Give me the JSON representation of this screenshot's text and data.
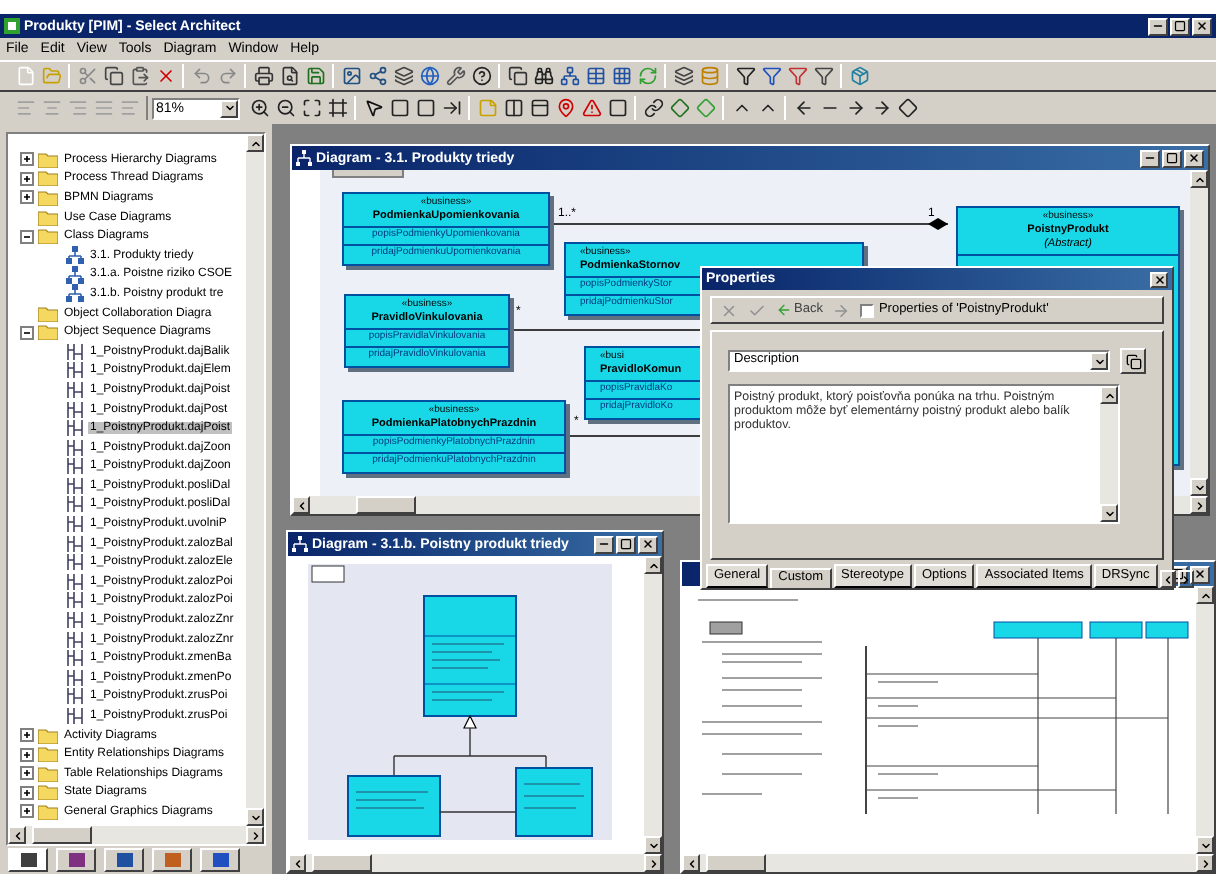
{
  "window": {
    "title": "Produkty [PIM] - Select Architect"
  },
  "menu": [
    "File",
    "Edit",
    "View",
    "Tools",
    "Diagram",
    "Window",
    "Help"
  ],
  "toolbar": {
    "zoom": "81%"
  },
  "tree": [
    {
      "label": "Process Hierarchy Diagrams",
      "kind": "folder",
      "expanded": false,
      "selected": false
    },
    {
      "label": "Process Thread Diagrams",
      "kind": "folder",
      "expanded": false,
      "selected": false
    },
    {
      "label": "BPMN Diagrams",
      "kind": "folder",
      "expanded": false,
      "selected": false
    },
    {
      "label": "Use Case Diagrams",
      "kind": "folder",
      "selected": false
    },
    {
      "label": "Class Diagrams",
      "kind": "folder",
      "expanded": true,
      "selected": false,
      "children": [
        {
          "label": "3.1. Produkty triedy",
          "kind": "class",
          "selected": false
        },
        {
          "label": "3.1.a. Poistne riziko CSOE",
          "kind": "class",
          "selected": false
        },
        {
          "label": "3.1.b. Poistny produkt tre",
          "kind": "class",
          "selected": false
        }
      ]
    },
    {
      "label": "Object Collaboration Diagra",
      "kind": "folder",
      "selected": false
    },
    {
      "label": "Object Sequence Diagrams",
      "kind": "folder",
      "expanded": true,
      "selected": false,
      "children": [
        {
          "label": "1_PoistnyProdukt.dajBalik",
          "kind": "sequence",
          "selected": false
        },
        {
          "label": "1_PoistnyProdukt.dajElem",
          "kind": "sequence",
          "selected": false
        },
        {
          "label": "1_PoistnyProdukt.dajPoist",
          "kind": "sequence",
          "selected": false
        },
        {
          "label": "1_PoistnyProdukt.dajPost",
          "kind": "sequence",
          "selected": false
        },
        {
          "label": "1_PoistnyProdukt.dajPoist",
          "kind": "sequence",
          "selected": true
        },
        {
          "label": "1_PoistnyProdukt.dajZoon",
          "kind": "sequence",
          "selected": false
        },
        {
          "label": "1_PoistnyProdukt.dajZoon",
          "kind": "sequence",
          "selected": false
        },
        {
          "label": "1_PoistnyProdukt.posliDal",
          "kind": "sequence",
          "selected": false
        },
        {
          "label": "1_PoistnyProdukt.posliDal",
          "kind": "sequence",
          "selected": false
        },
        {
          "label": "1_PoistnyProdukt.uvolniP",
          "kind": "sequence",
          "selected": false
        },
        {
          "label": "1_PoistnyProdukt.zalozBal",
          "kind": "sequence",
          "selected": false
        },
        {
          "label": "1_PoistnyProdukt.zalozEle",
          "kind": "sequence",
          "selected": false
        },
        {
          "label": "1_PoistnyProdukt.zalozPoi",
          "kind": "sequence",
          "selected": false
        },
        {
          "label": "1_PoistnyProdukt.zalozPoi",
          "kind": "sequence",
          "selected": false
        },
        {
          "label": "1_PoistnyProdukt.zalozZnr",
          "kind": "sequence",
          "selected": false
        },
        {
          "label": "1_PoistnyProdukt.zalozZnr",
          "kind": "sequence",
          "selected": false
        },
        {
          "label": "1_PoistnyProdukt.zmenBa",
          "kind": "sequence",
          "selected": false
        },
        {
          "label": "1_PoistnyProdukt.zmenPo",
          "kind": "sequence",
          "selected": false
        },
        {
          "label": "1_PoistnyProdukt.zrusPoi",
          "kind": "sequence",
          "selected": false
        },
        {
          "label": "1_PoistnyProdukt.zrusPoi",
          "kind": "sequence",
          "selected": false
        }
      ]
    },
    {
      "label": "Activity Diagrams",
      "kind": "folder",
      "expanded": false,
      "selected": false
    },
    {
      "label": "Entity Relationships Diagrams",
      "kind": "folder",
      "expanded": false,
      "selected": false
    },
    {
      "label": "Table Relationships Diagrams",
      "kind": "folder",
      "expanded": false,
      "selected": false
    },
    {
      "label": "State Diagrams",
      "kind": "folder",
      "expanded": false,
      "selected": false
    },
    {
      "label": "General Graphics Diagrams",
      "kind": "folder",
      "expanded": false,
      "selected": false
    }
  ],
  "navigator_tabs": [
    {
      "selected": true
    },
    {
      "selected": false
    },
    {
      "selected": false
    },
    {
      "selected": false
    },
    {
      "selected": false
    }
  ],
  "main_diagram": {
    "title": "Diagram - 3.1. Produkty triedy",
    "classes": [
      {
        "stereotype": "«business»",
        "name": "PodmienkaUpomienkovania",
        "operations": [
          "popisPodmienkyUpomienkovania",
          "pridajPodmienkuUpomienkovania"
        ]
      },
      {
        "stereotype": "«business»",
        "name": "PodmienkaStornov",
        "operations": [
          "popisPodmienkyStor",
          "pridajPodmienkuStor"
        ]
      },
      {
        "stereotype": "«business»",
        "name": "PravidloVinkulovania",
        "operations": [
          "popisPravidlaVinkulovania",
          "pridajPravidloVinkulovania"
        ]
      },
      {
        "stereotype": "«busi",
        "name": "PravidloKomun",
        "operations": [
          "popisPravidlaKo",
          "pridajPravidloKo"
        ]
      },
      {
        "stereotype": "«business»",
        "name": "PodmienkaPlatobnychPrazdnin",
        "operations": [
          "popisPodmienkyPlatobnychPrazdnin",
          "pridajPodmienkuPlatobnychPrazdnin"
        ]
      },
      {
        "stereotype": "«business»",
        "name": "PoistnyProdukt",
        "subtitle": "(Abstract)"
      }
    ],
    "multiplicities": [
      "1..*",
      "1",
      "*",
      "*"
    ]
  },
  "properties": {
    "title": "Properties",
    "back": "Back",
    "checkbox": {
      "label": "Properties of 'PoistnyProdukt'",
      "checked": false
    },
    "field": "Description",
    "text": "Poistný produkt, ktorý poisťovňa ponúka na trhu. Poistným produktom môže byť elementárny poistný produkt alebo balík produktov.",
    "tabs": [
      {
        "label": "General",
        "selected": false
      },
      {
        "label": "Custom",
        "selected": true
      },
      {
        "label": "Stereotype",
        "selected": false
      },
      {
        "label": "Options",
        "selected": false
      },
      {
        "label": "Associated Items",
        "selected": false
      },
      {
        "label": "DRSync",
        "selected": false
      }
    ]
  },
  "small_diagram": {
    "title": "Diagram - 3.1.b. Poistny produkt triedy"
  }
}
